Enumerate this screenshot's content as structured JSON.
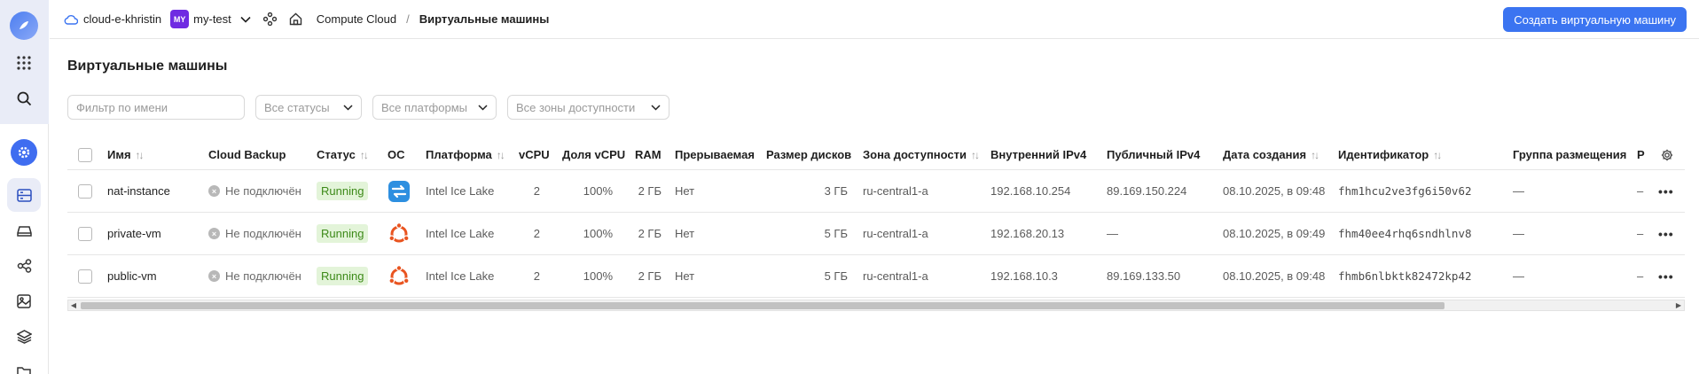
{
  "header": {
    "cloud_name": "cloud-e-khristin",
    "folder_badge": "MY",
    "folder_name": "my-test",
    "breadcrumb_service": "Compute Cloud",
    "breadcrumb_sep": "/",
    "breadcrumb_current": "Виртуальные машины",
    "create_button": "Создать виртуальную машину"
  },
  "page": {
    "title": "Виртуальные машины"
  },
  "filters": {
    "name_placeholder": "Фильтр по имени",
    "status": "Все статусы",
    "platform": "Все платформы",
    "zone": "Все зоны доступности"
  },
  "table": {
    "columns": {
      "name": "Имя",
      "backup": "Cloud Backup",
      "status": "Статус",
      "os": "ОС",
      "platform": "Платформа",
      "vcpu": "vCPU",
      "vcpu_share": "Доля vCPU",
      "ram": "RAM",
      "preemptible": "Прерываемая",
      "disk_size": "Размер дисков",
      "zone": "Зона доступности",
      "ipv4_internal": "Внутренний IPv4",
      "ipv4_public": "Публичный IPv4",
      "created": "Дата создания",
      "id": "Идентификатор",
      "placement_group": "Группа размещения",
      "truncated": "Р"
    },
    "rows": [
      {
        "name": "nat-instance",
        "backup": "Не подключён",
        "status": "Running",
        "os_icon": "nat-instance-os-icon",
        "platform": "Intel Ice Lake",
        "vcpu": "2",
        "vcpu_share": "100%",
        "ram": "2 ГБ",
        "preemptible": "Нет",
        "disk_size": "3 ГБ",
        "zone": "ru-central1-a",
        "ipv4_internal": "192.168.10.254",
        "ipv4_public": "89.169.150.224",
        "created": "08.10.2025, в 09:48",
        "id": "fhm1hcu2ve3fg6i50v62",
        "placement_group": "—",
        "truncated": "–"
      },
      {
        "name": "private-vm",
        "backup": "Не подключён",
        "status": "Running",
        "os_icon": "ubuntu-os-icon",
        "platform": "Intel Ice Lake",
        "vcpu": "2",
        "vcpu_share": "100%",
        "ram": "2 ГБ",
        "preemptible": "Нет",
        "disk_size": "5 ГБ",
        "zone": "ru-central1-a",
        "ipv4_internal": "192.168.20.13",
        "ipv4_public": "—",
        "created": "08.10.2025, в 09:49",
        "id": "fhm40ee4rhq6sndhlnv8",
        "placement_group": "—",
        "truncated": "–"
      },
      {
        "name": "public-vm",
        "backup": "Не подключён",
        "status": "Running",
        "os_icon": "ubuntu-os-icon",
        "platform": "Intel Ice Lake",
        "vcpu": "2",
        "vcpu_share": "100%",
        "ram": "2 ГБ",
        "preemptible": "Нет",
        "disk_size": "5 ГБ",
        "zone": "ru-central1-a",
        "ipv4_internal": "192.168.10.3",
        "ipv4_public": "89.169.133.50",
        "created": "08.10.2025, в 09:48",
        "id": "fhmb6nlbktk82472kp42",
        "placement_group": "—",
        "truncated": "–"
      }
    ]
  },
  "colors": {
    "accent": "#3b74f1",
    "running_bg": "#e3f4d9",
    "running_text": "#3d8a19",
    "ubuntu": "#e95420",
    "nat_os": "#2d8fe0",
    "folder_badge": "#6f2be2"
  }
}
